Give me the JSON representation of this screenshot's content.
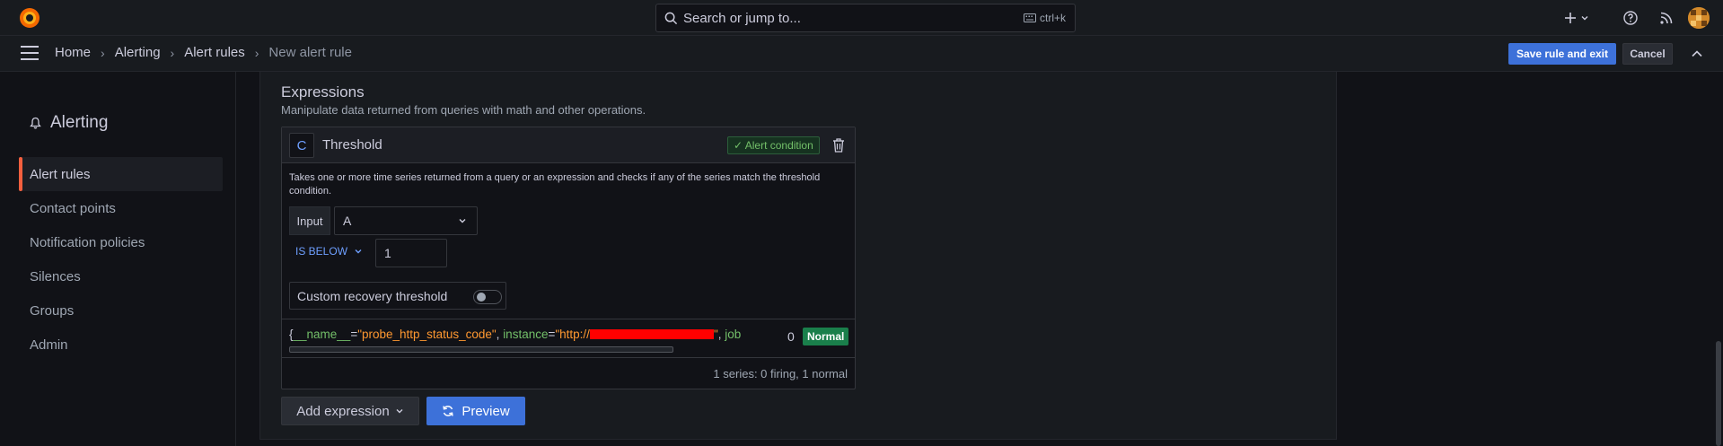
{
  "topbar": {
    "search_placeholder": "Search or jump to...",
    "search_shortcut": "ctrl+k",
    "icons": [
      "grafana-logo-icon",
      "search-icon",
      "keyboard-icon",
      "plus-icon",
      "help-icon",
      "rss-icon",
      "avatar"
    ]
  },
  "breadcrumb": {
    "items": [
      "Home",
      "Alerting",
      "Alert rules"
    ],
    "current": "New alert rule",
    "separator": "›"
  },
  "actions": {
    "save_label": "Save rule and exit",
    "cancel_label": "Cancel"
  },
  "sidebar": {
    "title": "Alerting",
    "items": [
      {
        "label": "Alert rules",
        "active": true
      },
      {
        "label": "Contact points",
        "active": false
      },
      {
        "label": "Notification policies",
        "active": false
      },
      {
        "label": "Silences",
        "active": false
      },
      {
        "label": "Groups",
        "active": false
      },
      {
        "label": "Admin",
        "active": false
      }
    ]
  },
  "expressions": {
    "title": "Expressions",
    "description": "Manipulate data returned from queries with math and other operations.",
    "card": {
      "ref_id": "C",
      "type": "Threshold",
      "condition_badge": "✓ Alert condition",
      "description": "Takes one or more time series returned from a query or an expression and checks if any of the series match the threshold condition.",
      "input_label": "Input",
      "input_value": "A",
      "operator": "IS BELOW",
      "threshold_value": "1",
      "recovery_label": "Custom recovery threshold",
      "recovery_enabled": false,
      "series": {
        "brace_open": "{",
        "name_key": "__name__",
        "eq": "=",
        "name_value": "\"probe_http_status_code\"",
        "comma": ", ",
        "instance_key": "instance",
        "instance_value_prefix": "\"http://",
        "instance_value_suffix": "\"",
        "job_key": "job",
        "value": "0",
        "state": "Normal"
      },
      "summary": "1 series: 0 firing, 1 normal"
    },
    "add_label": "Add expression",
    "preview_label": "Preview"
  },
  "colors": {
    "accent": "#3d71d9",
    "active_marker": "#f55f3e",
    "normal_state": "#1a7f4b",
    "label_key": "#73bf69",
    "label_value": "#ff9830"
  }
}
